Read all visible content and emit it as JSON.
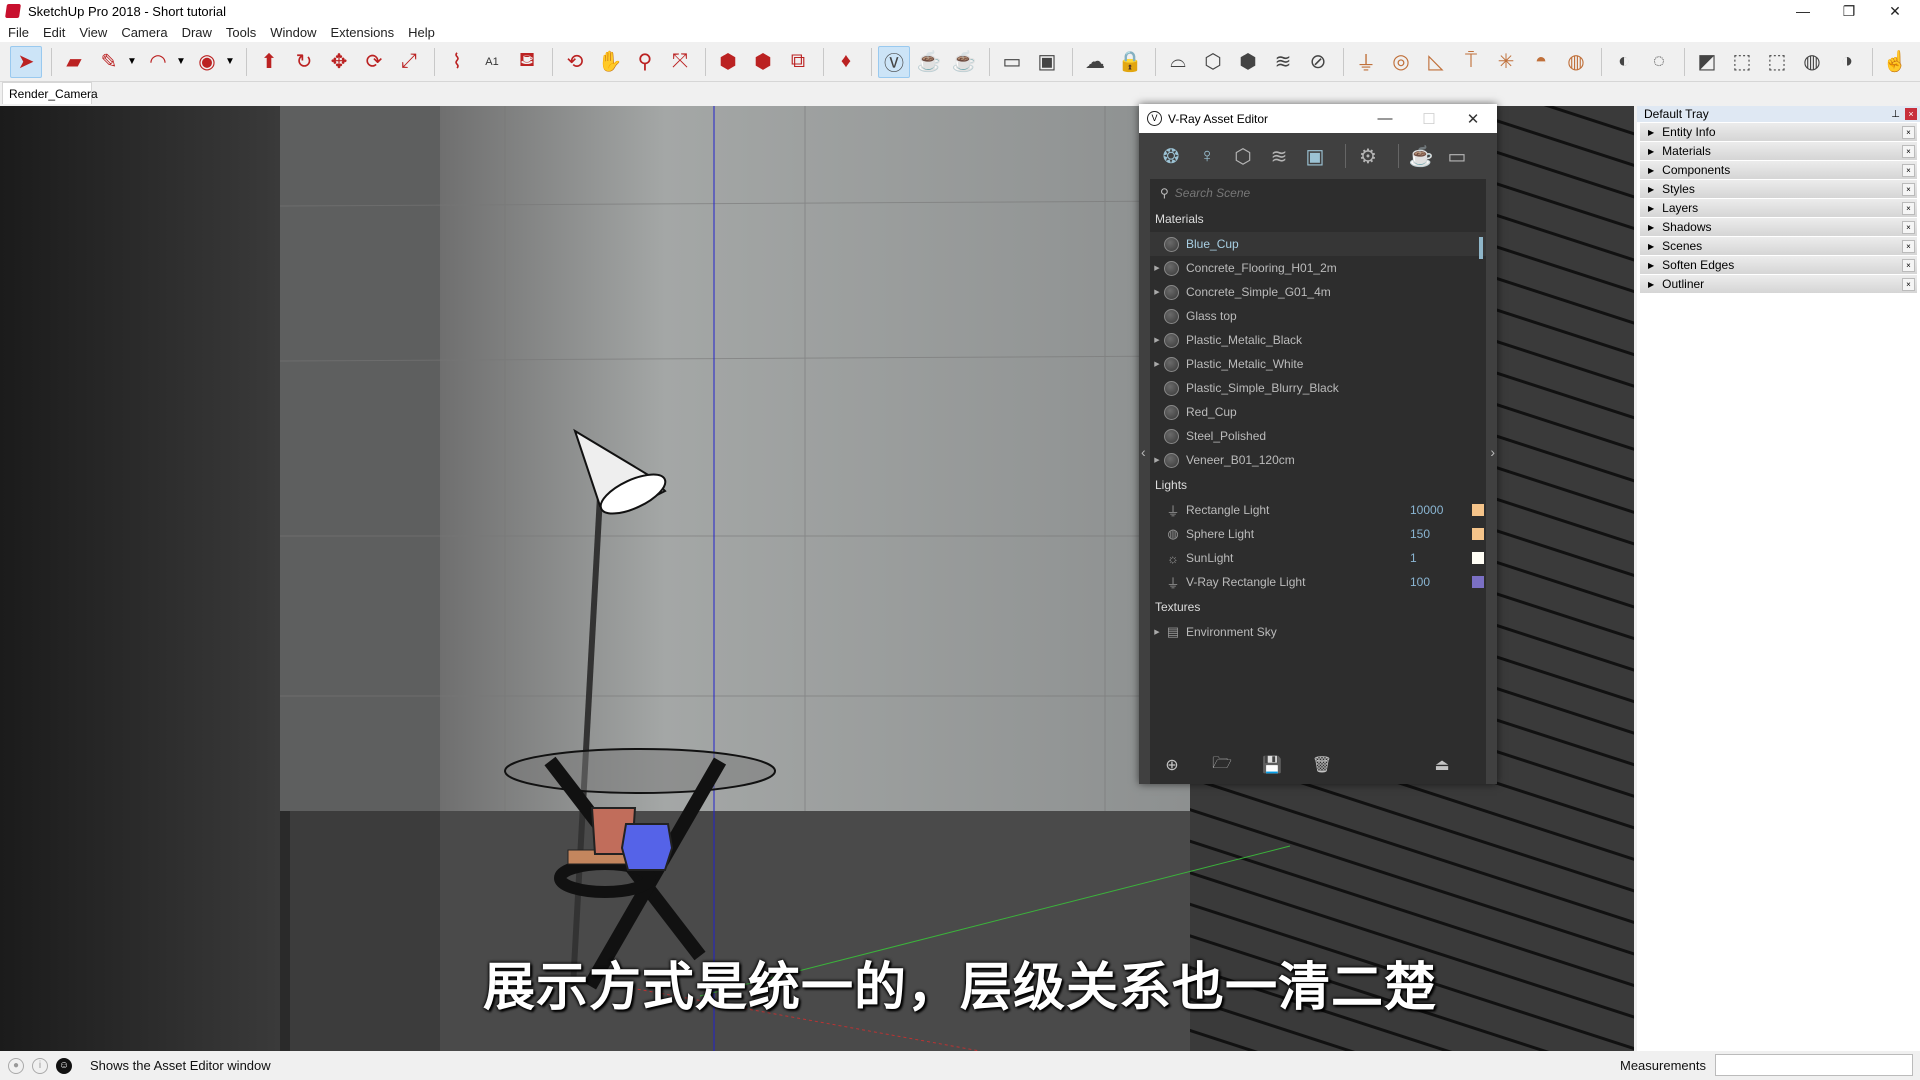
{
  "window": {
    "title": "SketchUp Pro 2018 - Short tutorial",
    "minimize": "—",
    "restore": "❐",
    "close": "✕"
  },
  "menu": [
    "File",
    "Edit",
    "View",
    "Camera",
    "Draw",
    "Tools",
    "Window",
    "Extensions",
    "Help"
  ],
  "toolbar": {
    "tools": [
      {
        "name": "select-tool",
        "glyph": "➤"
      },
      {
        "name": "eraser-tool",
        "glyph": "▰"
      },
      {
        "name": "line-tool",
        "glyph": "✎"
      },
      {
        "name": "arc-tool",
        "glyph": "◠"
      },
      {
        "name": "circle-tool",
        "glyph": "◉"
      },
      {
        "name": "push-pull-tool",
        "glyph": "⬆"
      },
      {
        "name": "follow-me-tool",
        "glyph": "↻"
      },
      {
        "name": "move-tool",
        "glyph": "✥"
      },
      {
        "name": "rotate-tool",
        "glyph": "⟳"
      },
      {
        "name": "scale-tool",
        "glyph": "⤢"
      },
      {
        "name": "tape-measure-tool",
        "glyph": "⌇"
      },
      {
        "name": "text-tool",
        "glyph": "A1"
      },
      {
        "name": "paint-bucket-tool",
        "glyph": "⛾"
      },
      {
        "name": "orbit-tool",
        "glyph": "⟲"
      },
      {
        "name": "pan-tool",
        "glyph": "✋"
      },
      {
        "name": "zoom-tool",
        "glyph": "⚲"
      },
      {
        "name": "zoom-extents-tool",
        "glyph": "⤧"
      },
      {
        "name": "3d-warehouse",
        "glyph": "⬢"
      },
      {
        "name": "extension-warehouse",
        "glyph": "⬢"
      },
      {
        "name": "send-to-layout",
        "glyph": "⧉"
      },
      {
        "name": "extension-manager",
        "glyph": "♦"
      },
      {
        "name": "vray-asset-editor",
        "glyph": "Ⓥ"
      },
      {
        "name": "vray-render",
        "glyph": "☕"
      },
      {
        "name": "vray-interactive-render",
        "glyph": "☕"
      },
      {
        "name": "vray-render-region",
        "glyph": "▭"
      },
      {
        "name": "vray-frame-buffer",
        "glyph": "▣"
      },
      {
        "name": "vray-cloud",
        "glyph": "☁"
      },
      {
        "name": "vray-lock",
        "glyph": "🔒"
      },
      {
        "name": "vray-infinite-plane",
        "glyph": "⌓"
      },
      {
        "name": "vray-export-proxy",
        "glyph": "⬡"
      },
      {
        "name": "vray-import-proxy",
        "glyph": "⬢"
      },
      {
        "name": "vray-fur",
        "glyph": "≋"
      },
      {
        "name": "vray-mesh-clipper",
        "glyph": "⊘"
      },
      {
        "name": "vray-rectangle-light",
        "glyph": "⏚"
      },
      {
        "name": "vray-sphere-light",
        "glyph": "◎"
      },
      {
        "name": "vray-spot-light",
        "glyph": "◺"
      },
      {
        "name": "vray-ies-light",
        "glyph": "⍑"
      },
      {
        "name": "vray-omni-light",
        "glyph": "✳"
      },
      {
        "name": "vray-dome-light",
        "glyph": "◓"
      },
      {
        "name": "vray-mesh-light",
        "glyph": "◍"
      },
      {
        "name": "vray-object-id",
        "glyph": "◐"
      },
      {
        "name": "vray-selection",
        "glyph": "◌"
      },
      {
        "name": "vray-uvw-1",
        "glyph": "◩"
      },
      {
        "name": "vray-uvw-2",
        "glyph": "⬚"
      },
      {
        "name": "vray-uvw-3",
        "glyph": "⬚"
      },
      {
        "name": "vray-uvw-4",
        "glyph": "◍"
      },
      {
        "name": "vray-uvw-5",
        "glyph": "◑"
      },
      {
        "name": "vray-pick-object",
        "glyph": "☝"
      }
    ]
  },
  "scene_tab": "Render_Camera",
  "tray": {
    "title": "Default Tray",
    "panels": [
      "Entity Info",
      "Materials",
      "Components",
      "Styles",
      "Layers",
      "Shadows",
      "Scenes",
      "Soften Edges",
      "Outliner"
    ]
  },
  "vray": {
    "title": "V-Ray Asset Editor",
    "search_placeholder": "Search Scene",
    "categories": {
      "materials": "Materials",
      "lights": "Lights",
      "textures": "Textures"
    },
    "materials": [
      {
        "name": "Blue_Cup",
        "expandable": false,
        "selected": true
      },
      {
        "name": "Concrete_Flooring_H01_2m",
        "expandable": true
      },
      {
        "name": "Concrete_Simple_G01_4m",
        "expandable": true
      },
      {
        "name": "Glass top",
        "expandable": false
      },
      {
        "name": "Plastic_Metalic_Black",
        "expandable": true
      },
      {
        "name": "Plastic_Metalic_White",
        "expandable": true
      },
      {
        "name": "Plastic_Simple_Blurry_Black",
        "expandable": false
      },
      {
        "name": "Red_Cup",
        "expandable": false
      },
      {
        "name": "Steel_Polished",
        "expandable": false
      },
      {
        "name": "Veneer_B01_120cm",
        "expandable": true
      }
    ],
    "lights": [
      {
        "name": "Rectangle Light",
        "value": "10000",
        "color": "#f5c48a",
        "icon": "rectangle-light-icon"
      },
      {
        "name": "Sphere Light",
        "value": "150",
        "color": "#f5c48a",
        "icon": "sphere-light-icon"
      },
      {
        "name": "SunLight",
        "value": "1",
        "color": "#fffdf5",
        "icon": "sun-icon"
      },
      {
        "name": "V-Ray Rectangle Light",
        "value": "100",
        "color": "#7b70c4",
        "icon": "rectangle-light-icon"
      }
    ],
    "textures": [
      {
        "name": "Environment Sky",
        "expandable": true
      }
    ]
  },
  "status": {
    "message": "Shows the Asset Editor window",
    "measurements_label": "Measurements",
    "measurements_value": ""
  },
  "subtitle": "展示方式是统一的，层级关系也一清二楚"
}
